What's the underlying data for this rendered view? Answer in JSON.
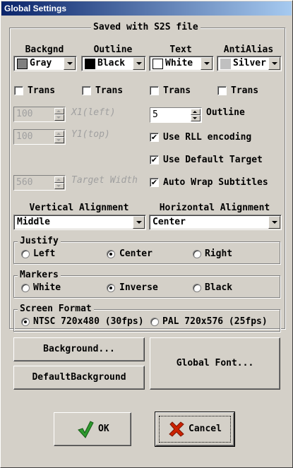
{
  "window": {
    "title": "Global Settings"
  },
  "saved_group": {
    "title": "Saved with S2S file"
  },
  "columns": [
    {
      "header": "Backgnd",
      "value": "Gray",
      "swatch": "#808080"
    },
    {
      "header": "Outline",
      "value": "Black",
      "swatch": "#000000"
    },
    {
      "header": "Text",
      "value": "White",
      "swatch": "#ffffff"
    },
    {
      "header": "AntiAlias",
      "value": "Silver",
      "swatch": "#c0c0c0"
    }
  ],
  "trans": {
    "label": "Trans"
  },
  "fields": {
    "x1": {
      "value": "100",
      "label": "X1(left)"
    },
    "y1": {
      "value": "100",
      "label": "Y1(top)"
    },
    "width": {
      "value": "560",
      "label": "Target Width"
    },
    "outline": {
      "value": "5",
      "label": "Outline"
    }
  },
  "options": {
    "rll": {
      "label": "Use RLL encoding",
      "checked": true
    },
    "default_target": {
      "label": "Use Default Target",
      "checked": true
    },
    "auto_wrap": {
      "label": "Auto Wrap Subtitles",
      "checked": true
    }
  },
  "alignment": {
    "vertical": {
      "header": "Vertical Alignment",
      "value": "Middle"
    },
    "horizontal": {
      "header": "Horizontal Alignment",
      "value": "Center"
    }
  },
  "justify": {
    "title": "Justify",
    "options": [
      "Left",
      "Center",
      "Right"
    ],
    "selected": "Center"
  },
  "markers": {
    "title": "Markers",
    "options": [
      "White",
      "Inverse",
      "Black"
    ],
    "selected": "Inverse"
  },
  "screen_format": {
    "title": "Screen Format",
    "options": [
      "NTSC 720x480 (30fps)",
      "PAL 720x576 (25fps)"
    ],
    "selected": "NTSC 720x480 (30fps)"
  },
  "buttons": {
    "background": "Background...",
    "default_background": "DefaultBackground",
    "global_font": "Global Font...",
    "ok": "OK",
    "cancel": "Cancel"
  },
  "icons": {
    "ok": "green-checkmark-icon",
    "cancel": "red-x-icon"
  },
  "colors": {
    "title_start": "#0a246a",
    "title_end": "#a6caf0",
    "ok_check": "#2e9a2e",
    "cancel_x": "#cc2200"
  }
}
